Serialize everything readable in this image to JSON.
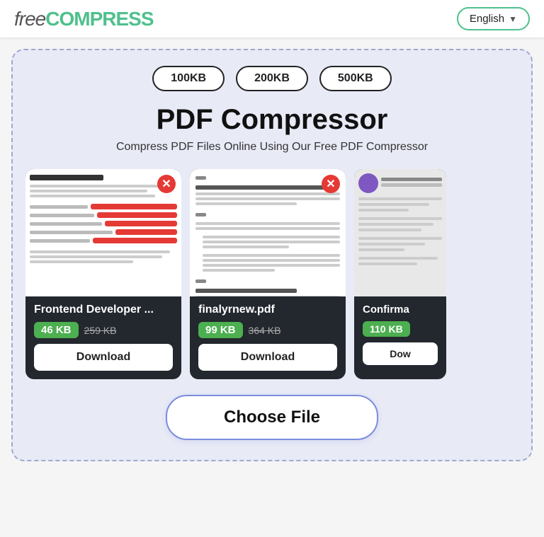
{
  "header": {
    "logo_free": "free",
    "logo_compress": "COMPRESS",
    "lang_label": "English",
    "lang_arrow": "▼"
  },
  "size_buttons": {
    "btn1": "100KB",
    "btn2": "200KB",
    "btn3": "500KB"
  },
  "main": {
    "title": "PDF Compressor",
    "subtitle": "Compress PDF Files Online Using Our Free PDF Compressor"
  },
  "cards": [
    {
      "filename": "Frontend Developer ...",
      "size_new": "46 KB",
      "size_old": "259 KB",
      "download_label": "Download"
    },
    {
      "filename": "finalyrnew.pdf",
      "size_new": "99 KB",
      "size_old": "364 KB",
      "download_label": "Download"
    },
    {
      "filename": "Confirma",
      "size_new": "110 KB",
      "size_old": "",
      "download_label": "Dow"
    }
  ],
  "choose_file_label": "Choose File",
  "colors": {
    "accent_green": "#4caf50",
    "brand_teal": "#4fc08d",
    "danger_red": "#e53935",
    "border_blue": "#7b8de0",
    "bg_light": "#e8eaf6"
  }
}
